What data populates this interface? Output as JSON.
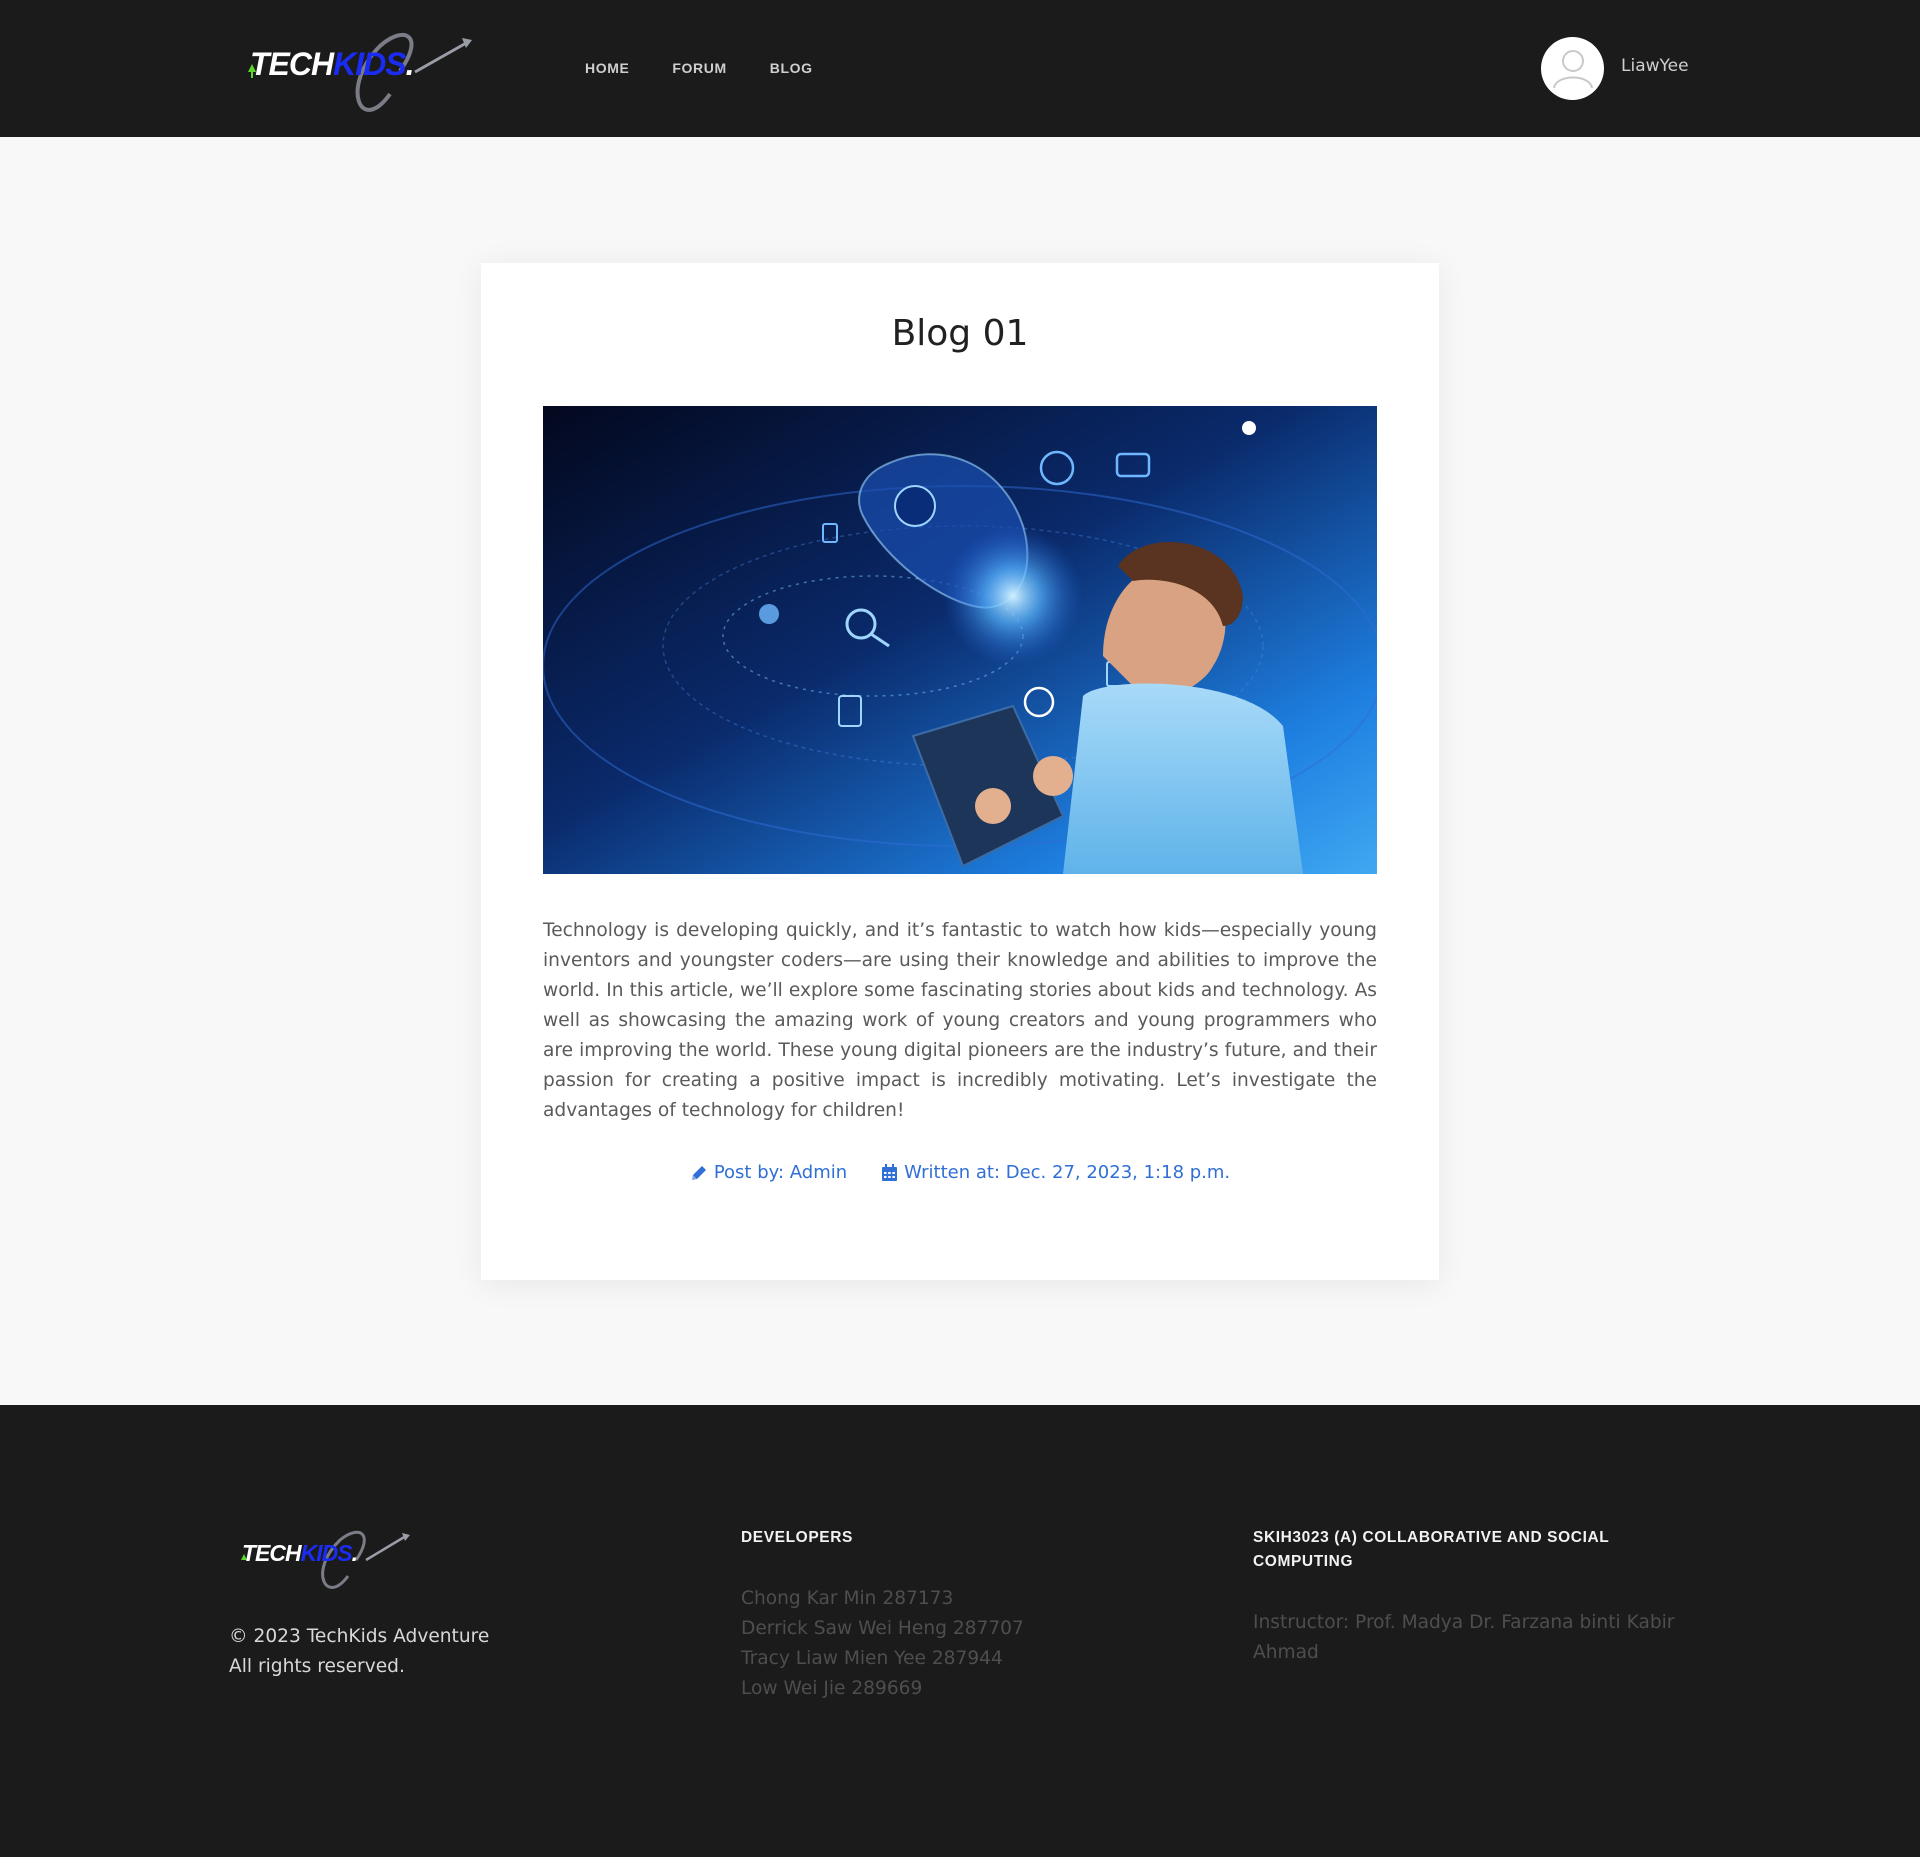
{
  "header": {
    "logo_alt": "TECHKIDS",
    "logo_tech": "TECH",
    "logo_kids": "KIDS",
    "nav": [
      {
        "label": "HOME"
      },
      {
        "label": "FORUM"
      },
      {
        "label": "BLOG"
      }
    ],
    "username": "LiawYee"
  },
  "post": {
    "title": "Blog 01",
    "body": "Technology is developing quickly, and it’s fantastic to watch how kids—especially young inventors and youngster coders—are using their knowledge and abilities to improve the world. In this article, we’ll explore some fascinating stories about kids and technology. As well as showcasing the amazing work of young creators and young programmers who are improving the world. These young digital pioneers are the industry’s future, and their passion for creating a positive impact is incredibly motivating. Let’s investigate the advantages of technology for children!",
    "author": "Post by: Admin",
    "written_at": "Written at: Dec. 27, 2023, 1:18 p.m."
  },
  "footer": {
    "copyright_line1": "© 2023 TechKids Adventure",
    "copyright_line2": "All rights reserved.",
    "developers_title": "DEVELOPERS",
    "developers": [
      "Chong Kar Min 287173",
      "Derrick Saw Wei Heng 287707",
      "Tracy Liaw Mien Yee 287944",
      "Low Wei Jie 289669"
    ],
    "course_title": "SKIH3023 (A) COLLABORATIVE AND SOCIAL COMPUTING",
    "instructor": "Instructor: Prof. Madya Dr. Farzana binti Kabir Ahmad"
  },
  "colors": {
    "header_bg": "#1b1b1c",
    "page_bg": "#f8f8f8",
    "link_blue": "#2f6fd6",
    "logo_blue": "#1b2cf2",
    "logo_green": "#5dd62c"
  }
}
